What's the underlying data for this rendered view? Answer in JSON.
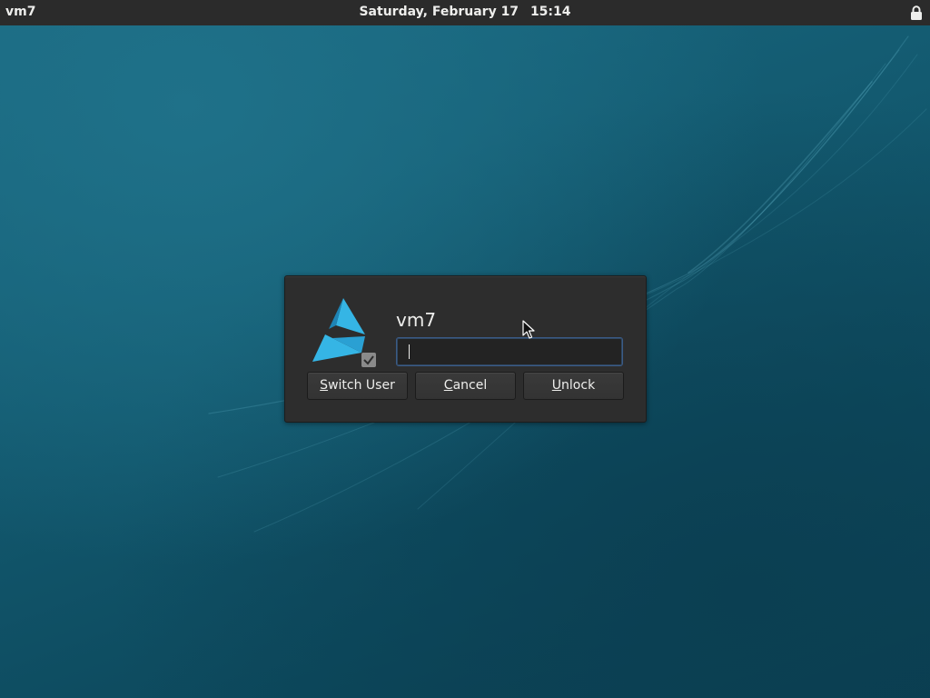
{
  "topbar": {
    "hostname": "vm7",
    "date": "Saturday, February 17",
    "time": "15:14",
    "status_icon": "lock-icon"
  },
  "dialog": {
    "avatar_icon": "fedora-logo-avatar-icon",
    "username": "vm7",
    "password": {
      "value": "",
      "placeholder": ""
    },
    "buttons": {
      "switch_user": {
        "mnemonic": "S",
        "rest": "witch User"
      },
      "cancel": {
        "mnemonic": "C",
        "rest": "ancel"
      },
      "unlock": {
        "mnemonic": "U",
        "rest": "nlock"
      }
    }
  },
  "colors": {
    "accent": "#3b5b87",
    "logo_blue": "#35b5e5",
    "panel": "#2b2b2b",
    "dialog": "#2d2d2d",
    "desktop": "#135a70"
  }
}
